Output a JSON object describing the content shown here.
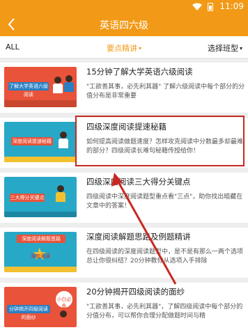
{
  "status_bar": {
    "time": "11:09"
  },
  "app_bar": {
    "back_icon": "chevron-left-icon",
    "title": "英语四六级"
  },
  "filter_bar": {
    "left_label": "ALL",
    "center_label": "要点精讲",
    "right_label": "选择班型"
  },
  "items": [
    {
      "title": "15分钟了解大学英语六级阅读",
      "desc": "\"工欲善其事，必先利其器\" 了解六级阅读中每个部分的分值分布是非常重要",
      "thumb_text": "了解大学英语六级阅读",
      "thumb_bg": "#e9533a"
    },
    {
      "title": "四级深度阅读提速秘籍",
      "desc": "如何提高阅读做题速度？怎样攻克阅读中分数最多却最难的部分？四级阅读长难句秘籍传授给你！",
      "thumb_text": "深度阅读提速秘籍",
      "thumb_bg": "#28a8c7"
    },
    {
      "title": "四级深度阅读三大得分关键点",
      "desc": "四级阅读中深度阅读题型重点看\"三点\"，助你找出暗藏在文章中的答案！",
      "thumb_text": "三大得分关键点",
      "thumb_bg": "#28a8c7"
    },
    {
      "title": "深度阅读解题思路及例题精讲",
      "desc": "在四级阅读的深度阅读题型中，是不是有那么一两个选项总让你很纠结？20分钟教你从选项入手排除",
      "thumb_text": "深度阅读解题思路",
      "badge_text": "深度阅读",
      "thumb_bg": "#28a8c7"
    },
    {
      "title": "20分钟揭开四级阅读的面纱",
      "desc": "\"工欲善其事，必先利其器\"，了解四级阅读中每个部分的分值分布，可以帮你合理分配做题时间与精",
      "thumb_text": "分钟揭开四级阅读的面纱",
      "badge_text": "小白必备",
      "thumb_bg": "#e9533a"
    }
  ],
  "colors": {
    "accent": "#f29a17",
    "highlight": "#c82822"
  }
}
